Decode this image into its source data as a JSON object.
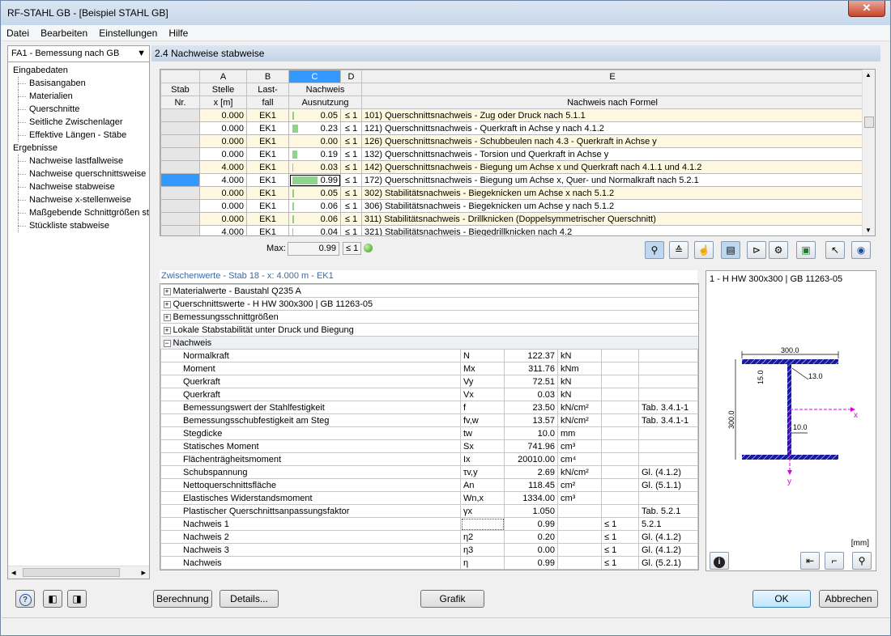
{
  "window": {
    "title": "RF-STAHL GB - [Beispiel STAHL GB]",
    "close": "✕"
  },
  "menu": [
    "Datei",
    "Bearbeiten",
    "Einstellungen",
    "Hilfe"
  ],
  "nav": {
    "selector": "FA1 - Bemessung nach GB",
    "tree": [
      {
        "label": "Eingabedaten",
        "level": 0
      },
      {
        "label": "Basisangaben",
        "level": 1
      },
      {
        "label": "Materialien",
        "level": 1
      },
      {
        "label": "Querschnitte",
        "level": 1
      },
      {
        "label": "Seitliche Zwischenlager",
        "level": 1
      },
      {
        "label": "Effektive Längen - Stäbe",
        "level": 1
      },
      {
        "label": "Ergebnisse",
        "level": 0
      },
      {
        "label": "Nachweise lastfallweise",
        "level": 1
      },
      {
        "label": "Nachweise querschnittsweise",
        "level": 1
      },
      {
        "label": "Nachweise stabweise",
        "level": 1
      },
      {
        "label": "Nachweise x-stellenweise",
        "level": 1
      },
      {
        "label": "Maßgebende Schnittgrößen sta",
        "level": 1
      },
      {
        "label": "Stückliste stabweise",
        "level": 1
      }
    ]
  },
  "panel_title": "2.4 Nachweise stabweise",
  "grid": {
    "col_letters": [
      "A",
      "B",
      "C",
      "D",
      "E"
    ],
    "head1": [
      "Stab",
      "Stelle",
      "Last-",
      "Nachweis",
      ""
    ],
    "head2": [
      "Nr.",
      "x [m]",
      "fall",
      "Ausnutzung",
      "Nachweis nach Formel"
    ],
    "rows": [
      {
        "x": "0.000",
        "lf": "EK1",
        "ratio": "0.05",
        "le": "≤ 1",
        "formula": "101) Querschnittsnachweis - Zug oder Druck nach 5.1.1",
        "bar": 0.05
      },
      {
        "x": "0.000",
        "lf": "EK1",
        "ratio": "0.23",
        "le": "≤ 1",
        "formula": "121) Querschnittsnachweis - Querkraft in Achse y nach 4.1.2",
        "bar": 0.23
      },
      {
        "x": "0.000",
        "lf": "EK1",
        "ratio": "0.00",
        "le": "≤ 1",
        "formula": "126) Querschnittsnachweis - Schubbeulen nach 4.3 - Querkraft in Achse y",
        "bar": 0.0
      },
      {
        "x": "0.000",
        "lf": "EK1",
        "ratio": "0.19",
        "le": "≤ 1",
        "formula": "132) Querschnittsnachweis - Torsion und Querkraft in Achse y",
        "bar": 0.19
      },
      {
        "x": "4.000",
        "lf": "EK1",
        "ratio": "0.03",
        "le": "≤ 1",
        "formula": "142) Querschnittsnachweis - Biegung um Achse x und Querkraft nach 4.1.1 und 4.1.2",
        "bar": 0.03
      },
      {
        "x": "4.000",
        "lf": "EK1",
        "ratio": "0.99",
        "le": "≤ 1",
        "formula": "172) Querschnittsnachweis - Biegung um Achse x, Quer- und Normalkraft nach 5.2.1",
        "bar": 0.99
      },
      {
        "x": "0.000",
        "lf": "EK1",
        "ratio": "0.05",
        "le": "≤ 1",
        "formula": "302) Stabilitätsnachweis - Biegeknicken um Achse x nach 5.1.2",
        "bar": 0.05
      },
      {
        "x": "0.000",
        "lf": "EK1",
        "ratio": "0.06",
        "le": "≤ 1",
        "formula": "306) Stabilitätsnachweis - Biegeknicken um Achse y nach 5.1.2",
        "bar": 0.06
      },
      {
        "x": "0.000",
        "lf": "EK1",
        "ratio": "0.06",
        "le": "≤ 1",
        "formula": "311) Stabilitätsnachweis - Drillknicken (Doppelsymmetrischer Querschnitt)",
        "bar": 0.06
      },
      {
        "x": "4.000",
        "lf": "EK1",
        "ratio": "0.04",
        "le": "≤ 1",
        "formula": "321) Stabilitätsnachweis - Biegedrillknicken nach 4.2",
        "bar": 0.04
      }
    ],
    "selected_row": 5,
    "max_label": "Max:",
    "max_value": "0.99",
    "max_le": "≤ 1"
  },
  "zw": {
    "title": "Zwischenwerte - Stab 18 - x: 4.000 m - EK1",
    "groups": [
      {
        "label": "Materialwerte  -  Baustahl Q235 A",
        "sign": "+"
      },
      {
        "label": "Querschnittswerte  -  H HW 300x300 | GB 11263-05",
        "sign": "+"
      },
      {
        "label": "Bemessungsschnittgrößen",
        "sign": "+"
      },
      {
        "label": "Lokale Stabstabilität unter Druck und Biegung",
        "sign": "+"
      },
      {
        "label": "Nachweis",
        "sign": "−"
      }
    ],
    "rows": [
      {
        "name": "Normalkraft",
        "sym": "N",
        "val": "122.37",
        "unit": "kN",
        "le": "",
        "ref": ""
      },
      {
        "name": "Moment",
        "sym": "Mx",
        "val": "311.76",
        "unit": "kNm",
        "le": "",
        "ref": ""
      },
      {
        "name": "Querkraft",
        "sym": "Vy",
        "val": "72.51",
        "unit": "kN",
        "le": "",
        "ref": ""
      },
      {
        "name": "Querkraft",
        "sym": "Vx",
        "val": "0.03",
        "unit": "kN",
        "le": "",
        "ref": ""
      },
      {
        "name": "Bemessungswert der Stahlfestigkeit",
        "sym": "f",
        "val": "23.50",
        "unit": "kN/cm²",
        "le": "",
        "ref": "Tab. 3.4.1-1"
      },
      {
        "name": "Bemessungsschubfestigkeit am Steg",
        "sym": "fv,w",
        "val": "13.57",
        "unit": "kN/cm²",
        "le": "",
        "ref": "Tab. 3.4.1-1"
      },
      {
        "name": "Stegdicke",
        "sym": "tw",
        "val": "10.0",
        "unit": "mm",
        "le": "",
        "ref": ""
      },
      {
        "name": "Statisches Moment",
        "sym": "Sx",
        "val": "741.96",
        "unit": "cm³",
        "le": "",
        "ref": ""
      },
      {
        "name": "Flächenträgheitsmoment",
        "sym": "Ix",
        "val": "20010.00",
        "unit": "cm⁴",
        "le": "",
        "ref": ""
      },
      {
        "name": "Schubspannung",
        "sym": "τv,y",
        "val": "2.69",
        "unit": "kN/cm²",
        "le": "",
        "ref": "Gl. (4.1.2)"
      },
      {
        "name": "Nettoquerschnittsfläche",
        "sym": "An",
        "val": "118.45",
        "unit": "cm²",
        "le": "",
        "ref": "Gl. (5.1.1)"
      },
      {
        "name": "Elastisches Widerstandsmoment",
        "sym": "Wn,x",
        "val": "1334.00",
        "unit": "cm³",
        "le": "",
        "ref": ""
      },
      {
        "name": "Plastischer Querschnittsanpassungsfaktor",
        "sym": "γx",
        "val": "1.050",
        "unit": "",
        "le": "",
        "ref": "Tab. 5.2.1"
      },
      {
        "name": "Nachweis 1",
        "sym": "",
        "val": "0.99",
        "unit": "",
        "le": "≤ 1",
        "ref": "5.2.1"
      },
      {
        "name": "Nachweis 2",
        "sym": "η2",
        "val": "0.20",
        "unit": "",
        "le": "≤ 1",
        "ref": "Gl. (4.1.2)"
      },
      {
        "name": "Nachweis 3",
        "sym": "η3",
        "val": "0.00",
        "unit": "",
        "le": "≤ 1",
        "ref": "Gl. (4.1.2)"
      },
      {
        "name": "Nachweis",
        "sym": "η",
        "val": "0.99",
        "unit": "",
        "le": "≤ 1",
        "ref": "Gl. (5.2.1)"
      }
    ]
  },
  "section": {
    "title": "1 - H HW 300x300 | GB 11263-05",
    "dim_top": "300.0",
    "dim_flange": "15.0",
    "dim_radius": "13.0",
    "dim_height": "300.0",
    "dim_web": "10.0",
    "axis_x": "x",
    "axis_y": "y",
    "unit": "[mm]"
  },
  "buttons": {
    "calc": "Berechnung",
    "details": "Details...",
    "graphic": "Grafik",
    "ok": "OK",
    "cancel": "Abbrechen"
  },
  "icons": {
    "help": "?",
    "prev": "◧",
    "next": "◨",
    "info": "i"
  },
  "colors": {
    "selection": "#3399ff",
    "axis": "#e000e0",
    "section_fill": "#1a1aa0",
    "bar": "#60c060"
  }
}
